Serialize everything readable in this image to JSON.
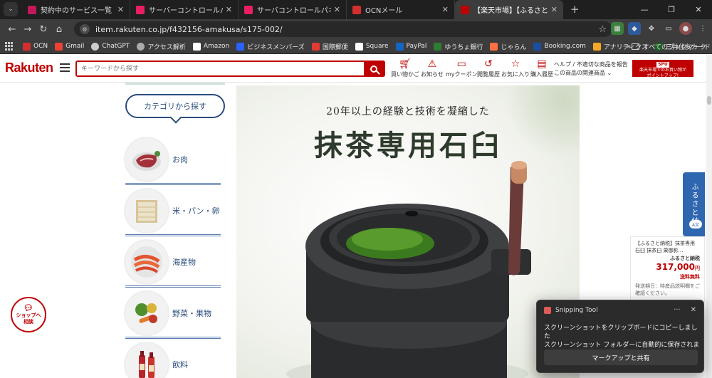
{
  "browser": {
    "tabs": [
      {
        "title": "契約中のサービス一覧｜さくらインターネット",
        "favicon_color": "#c2185b"
      },
      {
        "title": "サーバーコントロールパネル",
        "favicon_color": "#e91e63"
      },
      {
        "title": "サーバコントロールパネル - ファイルマネージャー",
        "favicon_color": "#e91e63"
      },
      {
        "title": "OCNメール",
        "favicon_color": "#d32f2f"
      },
      {
        "title": "【楽天市場】【ふるさと納税】抹茶専用石臼",
        "favicon_color": "#bf0000",
        "active": true
      }
    ],
    "new_tab": "+",
    "window_controls": [
      "minimize-icon",
      "restore-icon",
      "close-icon"
    ],
    "url": "item.rakuten.co.jp/f432156-amakusa/s175-002/",
    "bookmarks": [
      {
        "label": "OCN",
        "color": "#d32f2f"
      },
      {
        "label": "Gmail",
        "color": "#ea4335"
      },
      {
        "label": "ChatGPT",
        "color": "#cccccc"
      },
      {
        "label": "アクセス解析",
        "color": "#cccccc"
      },
      {
        "label": "Amazon",
        "color": "#ffffff"
      },
      {
        "label": "ビジネスメンバーズ",
        "color": "#2962ff"
      },
      {
        "label": "国際郵便",
        "color": "#e53935"
      },
      {
        "label": "Square",
        "color": "#ffffff"
      },
      {
        "label": "PayPal",
        "color": "#1565c0"
      },
      {
        "label": "ゆうちょ銀行",
        "color": "#2e7d32"
      },
      {
        "label": "じゃらん",
        "color": "#ff7043"
      },
      {
        "label": "Booking.com",
        "color": "#1a4fa0"
      },
      {
        "label": "アナリティクス",
        "color": "#f9a825"
      },
      {
        "label": "三井住友カード",
        "color": "#1b5e20"
      }
    ],
    "bookmarks_more": "»",
    "all_bookmarks": "すべてのブックマーク"
  },
  "header": {
    "logo": "Rakuten",
    "search_placeholder": "キーワードから探す",
    "nav": [
      {
        "label": "買い物かご",
        "icon": "cart-icon"
      },
      {
        "label": "お知らせ",
        "icon": "notice-icon"
      },
      {
        "label": "myクーポン",
        "icon": "coupon-icon"
      },
      {
        "label": "閲覧履歴",
        "icon": "history-icon"
      },
      {
        "label": "お気に入り",
        "icon": "star-icon"
      },
      {
        "label": "購入履歴",
        "icon": "receipt-icon"
      }
    ],
    "help_line1": "ヘルプ / 不適切な商品を報告",
    "help_line2": "この商品の関連商品",
    "spu_tag": "SPU",
    "spu_line1": "楽天市場でのお買い物が",
    "spu_line2": "ポイントアップ!"
  },
  "sidebar": {
    "title": "カテゴリから探す",
    "categories": [
      {
        "label": "お肉",
        "icon": "meat-icon"
      },
      {
        "label": "米・パン・卵",
        "icon": "rice-icon"
      },
      {
        "label": "海産物",
        "icon": "seafood-icon"
      },
      {
        "label": "野菜・果物",
        "icon": "vegetable-icon"
      },
      {
        "label": "飲料",
        "icon": "drink-icon"
      }
    ]
  },
  "hero": {
    "subtitle": "20年以上の経験と技術を凝縮した",
    "title": "抹茶専用石臼"
  },
  "floating": {
    "furusato_tab": "ふるさと納",
    "translate_label": "A文",
    "product": {
      "name": "【ふるさと納税】抹茶専用 石臼 抹茶臼 果御影…",
      "type": "ふるさと納税",
      "price": "317,000",
      "currency": "円",
      "shipping": "送料無料",
      "note": "発送期日：特産品説明欄をご確認ください。"
    },
    "shop_chat_line1": "ショップへ",
    "shop_chat_line2": "相談"
  },
  "toast": {
    "app": "Snipping Tool",
    "more": "···",
    "close": "✕",
    "line1": "スクリーンショットをクリップボードにコピーしました",
    "line2": "スクリーンショット フォルダーに自動的に保存されました。",
    "action": "マークアップと共有"
  },
  "colors": {
    "brand": "#bf0000",
    "category_blue": "#2b4c7e",
    "chrome_dark": "#1f1f1f"
  }
}
